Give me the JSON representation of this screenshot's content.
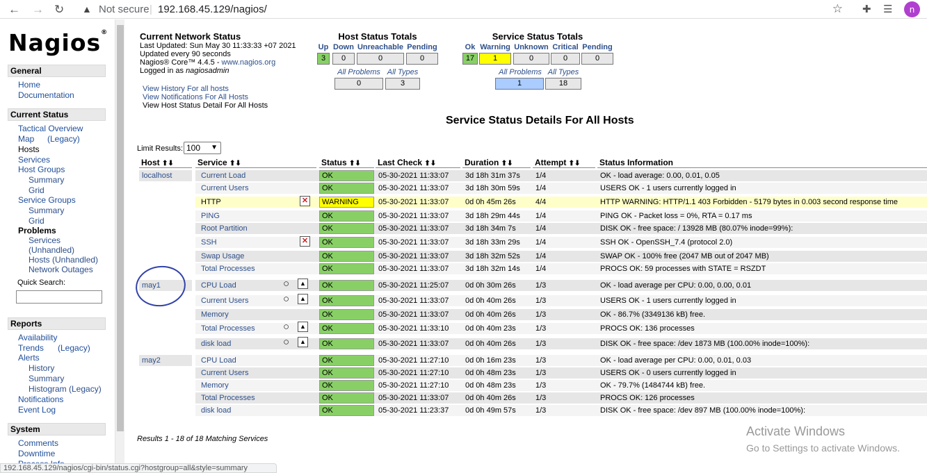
{
  "browser": {
    "back_icon": "←",
    "forward_icon": "→",
    "reload_icon": "↻",
    "not_secure": "Not secure",
    "url": "192.168.45.129/nagios/",
    "profile_initial": "n",
    "status_url": "192.168.45.129/nagios/cgi-bin/status.cgi?hostgroup=all&style=summary"
  },
  "sidebar": {
    "logo": "Nagios",
    "logo_reg": "®",
    "general_header": "General",
    "home": "Home",
    "documentation": "Documentation",
    "current_status_header": "Current Status",
    "tactical_overview": "Tactical Overview",
    "map": "Map",
    "map_legacy": "(Legacy)",
    "hosts": "Hosts",
    "services": "Services",
    "host_groups": "Host Groups",
    "hg_summary": "Summary",
    "hg_grid": "Grid",
    "service_groups": "Service Groups",
    "sg_summary": "Summary",
    "sg_grid": "Grid",
    "problems": "Problems",
    "p_services": "Services",
    "p_unhandled": "(Unhandled)",
    "p_hosts": "Hosts (Unhandled)",
    "p_outages": "Network Outages",
    "quick_search": "Quick Search:",
    "reports_header": "Reports",
    "availability": "Availability",
    "trends": "Trends",
    "trends_legacy": "(Legacy)",
    "alerts": "Alerts",
    "a_history": "History",
    "a_summary": "Summary",
    "a_histogram": "Histogram (Legacy)",
    "notifications": "Notifications",
    "event_log": "Event Log",
    "system_header": "System",
    "comments": "Comments",
    "downtime": "Downtime",
    "process_info": "Process Info"
  },
  "header": {
    "title": "Current Network Status",
    "last_updated": "Last Updated: Sun May 30 11:33:33 +07 2021",
    "update_interval": "Updated every 90 seconds",
    "version_prefix": "Nagios® Core™ 4.4.5 - ",
    "version_link": "www.nagios.org",
    "logged_in_prefix": "Logged in as ",
    "logged_in_user": "nagiosadmin",
    "link_history": "View History For all hosts",
    "link_notifications": "View Notifications For All Hosts",
    "link_host_detail": "View Host Status Detail For All Hosts"
  },
  "host_totals": {
    "title": "Host Status Totals",
    "labels": [
      "Up",
      "Down",
      "Unreachable",
      "Pending"
    ],
    "values": [
      "3",
      "0",
      "0",
      "0"
    ],
    "all_problems_label": "All Problems",
    "all_types_label": "All Types",
    "all_problems": "0",
    "all_types": "3"
  },
  "service_totals": {
    "title": "Service Status Totals",
    "labels": [
      "Ok",
      "Warning",
      "Unknown",
      "Critical",
      "Pending"
    ],
    "values": [
      "17",
      "1",
      "0",
      "0",
      "0"
    ],
    "all_problems_label": "All Problems",
    "all_types_label": "All Types",
    "all_problems": "1",
    "all_types": "18"
  },
  "page_title": "Service Status Details For All Hosts",
  "limit_label": "Limit Results:",
  "limit_value": "100",
  "columns": [
    "Host",
    "Service",
    "Status",
    "Last Check",
    "Duration",
    "Attempt",
    "Status Information"
  ],
  "sort_icon": "⬆⬇",
  "rows": [
    {
      "host": "localhost",
      "service": "Current Load",
      "status": "OK",
      "last": "05-30-2021 11:33:07",
      "dur": "3d 18h 31m 37s",
      "att": "1/4",
      "info": "OK - load average: 0.00, 0.01, 0.05"
    },
    {
      "host": "",
      "service": "Current Users",
      "status": "OK",
      "last": "05-30-2021 11:33:07",
      "dur": "3d 18h 30m 59s",
      "att": "1/4",
      "info": "USERS OK - 1 users currently logged in"
    },
    {
      "host": "",
      "service": "HTTP",
      "status": "WARNING",
      "last": "05-30-2021 11:33:07",
      "dur": "0d 0h 45m 26s",
      "att": "4/4",
      "info": "HTTP WARNING: HTTP/1.1 403 Forbidden - 5179 bytes in 0.003 second response time"
    },
    {
      "host": "",
      "service": "PING",
      "status": "OK",
      "last": "05-30-2021 11:33:07",
      "dur": "3d 18h 29m 44s",
      "att": "1/4",
      "info": "PING OK - Packet loss = 0%, RTA = 0.17 ms"
    },
    {
      "host": "",
      "service": "Root Partition",
      "status": "OK",
      "last": "05-30-2021 11:33:07",
      "dur": "3d 18h 34m 7s",
      "att": "1/4",
      "info": "DISK OK - free space: / 13928 MB (80.07% inode=99%):"
    },
    {
      "host": "",
      "service": "SSH",
      "status": "OK",
      "last": "05-30-2021 11:33:07",
      "dur": "3d 18h 33m 29s",
      "att": "1/4",
      "info": "SSH OK - OpenSSH_7.4 (protocol 2.0)"
    },
    {
      "host": "",
      "service": "Swap Usage",
      "status": "OK",
      "last": "05-30-2021 11:33:07",
      "dur": "3d 18h 32m 52s",
      "att": "1/4",
      "info": "SWAP OK - 100% free (2047 MB out of 2047 MB)"
    },
    {
      "host": "",
      "service": "Total Processes",
      "status": "OK",
      "last": "05-30-2021 11:33:07",
      "dur": "3d 18h 32m 14s",
      "att": "1/4",
      "info": "PROCS OK: 59 processes with STATE = RSZDT"
    },
    {
      "host": "may1",
      "service": "CPU Load",
      "status": "OK",
      "last": "05-30-2021 11:25:07",
      "dur": "0d 0h 30m 26s",
      "att": "1/3",
      "info": "OK - load average per CPU: 0.00, 0.00, 0.01"
    },
    {
      "host": "",
      "service": "Current Users",
      "status": "OK",
      "last": "05-30-2021 11:33:07",
      "dur": "0d 0h 40m 26s",
      "att": "1/3",
      "info": "USERS OK - 1 users currently logged in"
    },
    {
      "host": "",
      "service": "Memory",
      "status": "OK",
      "last": "05-30-2021 11:33:07",
      "dur": "0d 0h 40m 26s",
      "att": "1/3",
      "info": "OK - 86.7% (3349136 kB) free."
    },
    {
      "host": "",
      "service": "Total Processes",
      "status": "OK",
      "last": "05-30-2021 11:33:10",
      "dur": "0d 0h 40m 23s",
      "att": "1/3",
      "info": "PROCS OK: 136 processes"
    },
    {
      "host": "",
      "service": "disk load",
      "status": "OK",
      "last": "05-30-2021 11:33:07",
      "dur": "0d 0h 40m 26s",
      "att": "1/3",
      "info": "DISK OK - free space: /dev 1873 MB (100.00% inode=100%):"
    },
    {
      "host": "may2",
      "service": "CPU Load",
      "status": "OK",
      "last": "05-30-2021 11:27:10",
      "dur": "0d 0h 16m 23s",
      "att": "1/3",
      "info": "OK - load average per CPU: 0.00, 0.01, 0.03"
    },
    {
      "host": "",
      "service": "Current Users",
      "status": "OK",
      "last": "05-30-2021 11:27:10",
      "dur": "0d 0h 48m 23s",
      "att": "1/3",
      "info": "USERS OK - 0 users currently logged in"
    },
    {
      "host": "",
      "service": "Memory",
      "status": "OK",
      "last": "05-30-2021 11:27:10",
      "dur": "0d 0h 48m 23s",
      "att": "1/3",
      "info": "OK - 79.7% (1484744 kB) free."
    },
    {
      "host": "",
      "service": "Total Processes",
      "status": "OK",
      "last": "05-30-2021 11:33:07",
      "dur": "0d 0h 40m 26s",
      "att": "1/3",
      "info": "PROCS OK: 126 processes"
    },
    {
      "host": "",
      "service": "disk load",
      "status": "OK",
      "last": "05-30-2021 11:23:37",
      "dur": "0d 0h 49m 57s",
      "att": "1/3",
      "info": "DISK OK - free space: /dev 897 MB (100.00% inode=100%):"
    }
  ],
  "results_text": "Results 1 - 18 of 18 Matching Services",
  "activate": {
    "title": "Activate Windows",
    "subtitle": "Go to Settings to activate Windows."
  },
  "colors": {
    "ok": "#88d066",
    "warning": "#ffff00",
    "link": "#2d4f8a"
  }
}
